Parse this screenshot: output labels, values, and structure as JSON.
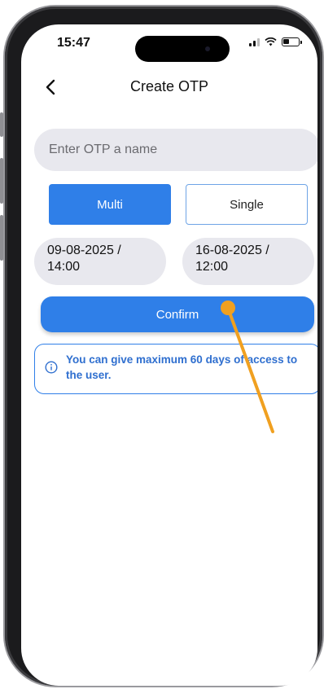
{
  "status_bar": {
    "time": "15:47"
  },
  "header": {
    "title": "Create OTP"
  },
  "form": {
    "name_placeholder": "Enter OTP a name",
    "name_value": "",
    "mode_options": {
      "multi": "Multi",
      "single": "Single",
      "selected": "Multi"
    },
    "start_date": "09-08-2025 /\n14:00",
    "end_date": "16-08-2025 /\n12:00",
    "confirm_label": "Confirm"
  },
  "info": {
    "message": "You can give maximum 60 days of access to the user."
  },
  "colors": {
    "accent": "#2f7fe8",
    "info_text": "#2f6fcf",
    "input_bg": "#e8e8ee",
    "pointer": "#f0a020"
  }
}
